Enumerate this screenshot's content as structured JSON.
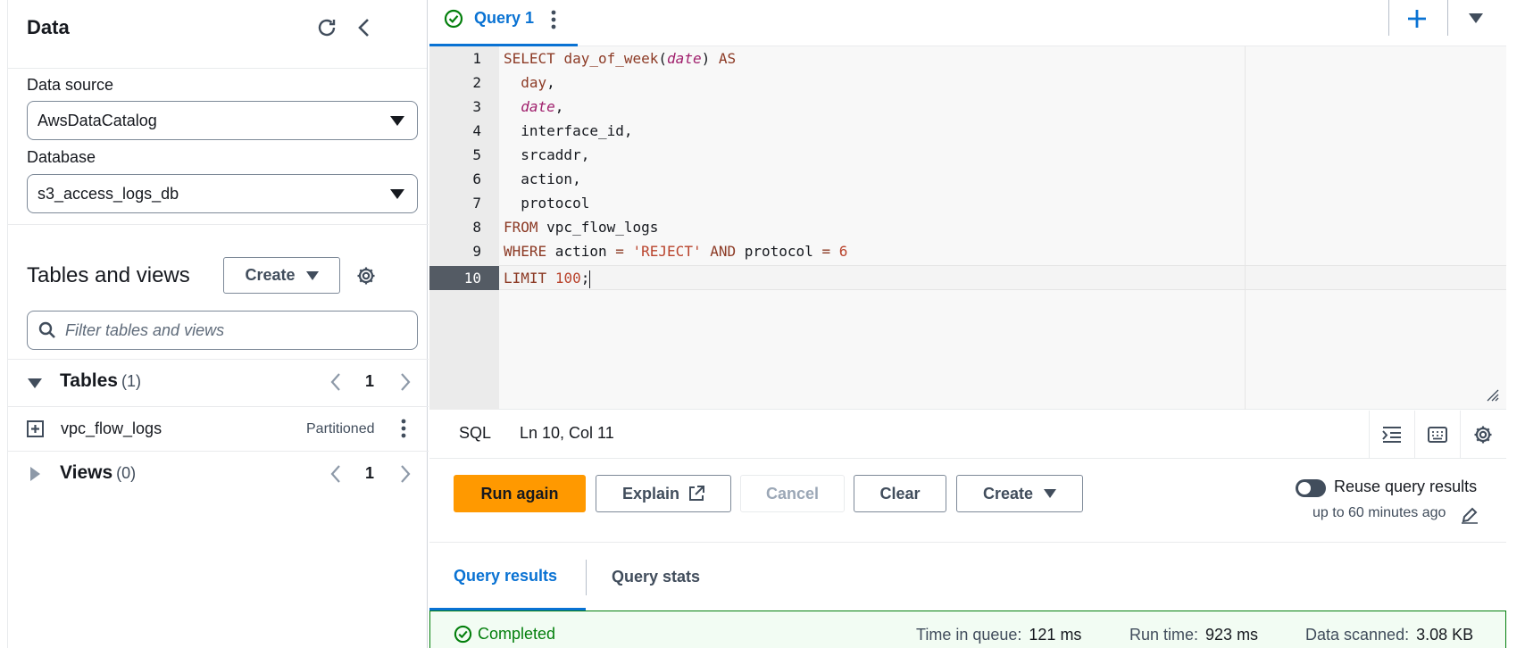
{
  "left_panel": {
    "title": "Data",
    "data_source_label": "Data source",
    "data_source_value": "AwsDataCatalog",
    "database_label": "Database",
    "database_value": "s3_access_logs_db",
    "tables_views_title": "Tables and views",
    "create_label": "Create",
    "filter_placeholder": "Filter tables and views",
    "tables": {
      "label": "Tables",
      "count": "(1)",
      "page": "1"
    },
    "table_item": {
      "name": "vpc_flow_logs",
      "badge": "Partitioned"
    },
    "views": {
      "label": "Views",
      "count": "(0)",
      "page": "1"
    }
  },
  "editor_tab": {
    "label": "Query 1"
  },
  "editor": {
    "line_numbers": [
      "1",
      "2",
      "3",
      "4",
      "5",
      "6",
      "7",
      "8",
      "9",
      "10"
    ],
    "active_line": "10"
  },
  "status_bar": {
    "language": "SQL",
    "position": "Ln 10, Col 11"
  },
  "actions": {
    "run_again": "Run again",
    "explain": "Explain",
    "cancel": "Cancel",
    "clear": "Clear",
    "create": "Create",
    "reuse_label": "Reuse query results",
    "reuse_sub": "up to 60 minutes ago",
    "reuse_enabled": false
  },
  "results_tabs": {
    "results": "Query results",
    "stats": "Query stats"
  },
  "completion": {
    "status": "Completed",
    "queue_label": "Time in queue:",
    "queue_value": "121 ms",
    "run_label": "Run time:",
    "run_value": "923 ms",
    "scanned_label": "Data scanned:",
    "scanned_value": "3.08 KB"
  },
  "colors": {
    "accent": "#0972d3",
    "primary_button": "#ff9900",
    "success": "#037f0c"
  },
  "icons": [
    "refresh-icon",
    "collapse-icon",
    "caret-down-icon",
    "settings-icon",
    "search-icon",
    "triangle-down-icon",
    "triangle-right-icon",
    "chevron-left-icon",
    "chevron-right-icon",
    "expand-box-icon",
    "kebab-icon",
    "check-circle-icon",
    "plus-icon",
    "indent-icon",
    "keyboard-icon",
    "external-link-icon",
    "edit-icon",
    "resize-icon"
  ]
}
